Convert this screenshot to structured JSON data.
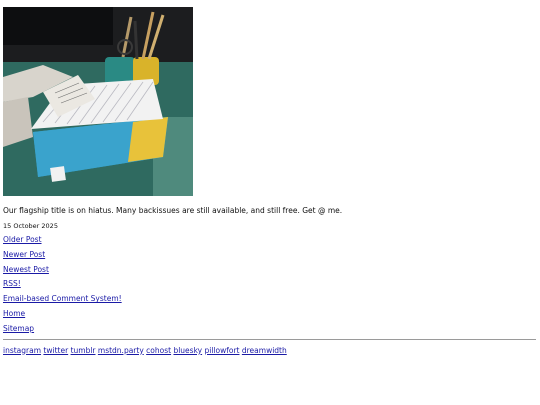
{
  "post": {
    "photo_alt_icon": "photo-zine-box",
    "caption": "Our flagship title is on hiatus. Many backissues are still available, and still free. Get @ me.",
    "date": "15 October 2025"
  },
  "nav": {
    "older": "Older Post",
    "newer": "Newer Post",
    "newest": "Newest Post",
    "rss": "RSS!",
    "comments": "Email-based Comment System!",
    "home": "Home",
    "sitemap": "Sitemap"
  },
  "social": {
    "instagram": "instagram",
    "twitter": "twitter",
    "tumblr": "tumblr",
    "mastodon": "mstdn.party",
    "cohost": "cohost",
    "bluesky": "bluesky",
    "pillowfort": "pillowfort",
    "dreamwidth": "dreamwidth"
  },
  "colors": {
    "link": "#1a1aa6",
    "text": "#111111",
    "rule": "#9a9a9a"
  }
}
